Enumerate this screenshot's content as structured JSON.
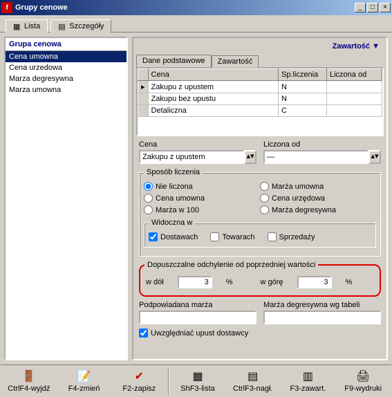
{
  "window": {
    "title": "Grupy cenowe"
  },
  "tabs": {
    "list": "Lista",
    "details": "Szczegóły"
  },
  "left": {
    "header": "Grupa cenowa",
    "items": [
      "Cena umowna",
      "Cena urzedowa",
      "Marza degresywna",
      "Marza umowna"
    ],
    "selected": 0
  },
  "right": {
    "header": "Zawartość",
    "inner_tabs": {
      "basic": "Dane podstawowe",
      "content": "Zawartość"
    },
    "grid": {
      "cols": [
        "Cena",
        "Sp.liczenia",
        "Liczona od"
      ],
      "rows": [
        {
          "ind": "▸",
          "c0": "Zakupu z upustem",
          "c1": "N",
          "c2": ""
        },
        {
          "ind": "",
          "c0": "Zakupu bez upustu",
          "c1": "N",
          "c2": ""
        },
        {
          "ind": "",
          "c0": "Detaliczna",
          "c1": "C",
          "c2": ""
        }
      ]
    },
    "cena_label": "Cena",
    "cena_value": "Zakupu z upustem",
    "liczona_label": "Liczona od",
    "liczona_value": "—",
    "sposob": {
      "legend": "Sposób liczenia",
      "opts": [
        "Nie liczona",
        "Marża umowna",
        "Cena umowna",
        "Cena urzędowa",
        "Marża w 100",
        "Marża degresywna"
      ],
      "selected": 0
    },
    "widoczna": {
      "legend": "Widoczna w",
      "opts": [
        "Dostawach",
        "Towarach",
        "Sprzedaży"
      ],
      "checked": [
        true,
        false,
        false
      ]
    },
    "odchyl": {
      "legend": "Dopuszczalne odchylenie od poprzedniej wartości",
      "dol_label": "w dół",
      "dol_val": "3",
      "pct": "%",
      "gore_label": "w górę",
      "gore_val": "3"
    },
    "marza_label": "Podpowiadana marża",
    "marza_deg_label": "Marża degresywna wg tabeli",
    "upust_label": "Uwzględniać upust dostawcy",
    "upust_checked": true
  },
  "toolbar": {
    "b0": "CtrlF4-wyjdź",
    "b1": "F4-zmień",
    "b2": "F2-zapisz",
    "b3": "ShF3-lista",
    "b4": "CtrlF3-nagł.",
    "b5": "F3-zawart.",
    "b6": "F9-wydruki"
  }
}
